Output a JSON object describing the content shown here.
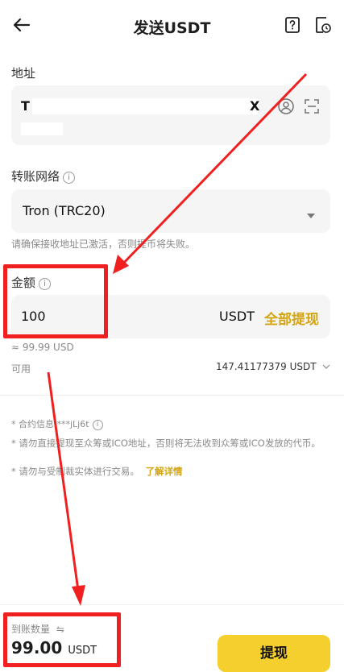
{
  "header": {
    "title": "发送USDT"
  },
  "address": {
    "label": "地址",
    "value_prefix": "T",
    "clear_symbol": "X"
  },
  "network": {
    "label": "转账网络",
    "selected": "Tron (TRC20)",
    "hint": "请确保接收地址已激活，否则提币将失败。"
  },
  "amount": {
    "label": "金额",
    "value": "100",
    "unit": "USDT",
    "max_label": "全部提现",
    "usd_equiv": "≈ 99.99 USD",
    "available_label": "可用",
    "available_value": "147.41177379 USDT"
  },
  "notes": {
    "contract": "* 合约信息 ***jLj6t",
    "line1": "* 请勿直接提现至众筹或ICO地址，否则将无法收到众筹或ICO发放的代币。",
    "line2": "* 请勿与受制裁实体进行交易。",
    "learn_more": "了解详情"
  },
  "footer": {
    "received_label": "到账数量",
    "received_value": "99.00",
    "received_unit": "USDT",
    "withdraw_label": "提现"
  },
  "colors": {
    "accent": "#f5cf2d",
    "link": "#d3a512",
    "annotation": "#f02020"
  }
}
